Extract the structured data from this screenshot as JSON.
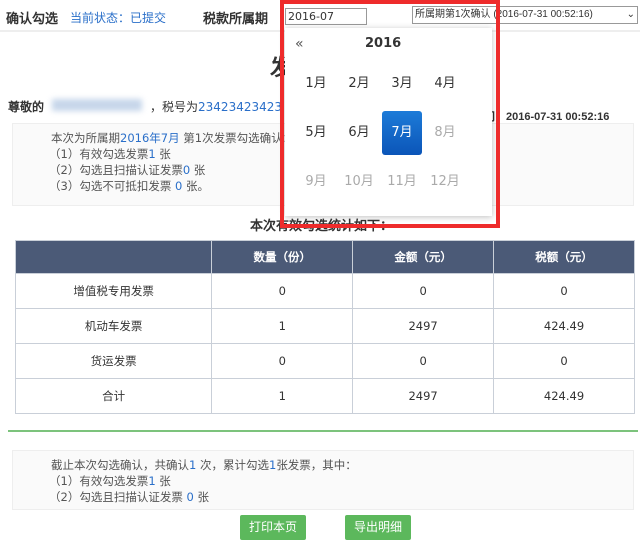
{
  "topbar": {
    "title": "确认勾选",
    "status": "当前状态：已提交",
    "period_label": "税款所属期",
    "period_value": "2016-07",
    "select_value": "所属期第1次确认 (2016-07-31 00:52:16)"
  },
  "main": {
    "heading": "发",
    "greeting": "尊敬的",
    "tax_label": "，税号为",
    "tax_id": "23423423423",
    "confirm_time": "认时间：2016-07-31 00:52:16"
  },
  "summary": {
    "line1_a": "本次为所属期",
    "line1_period": "2016年7月",
    "line1_b": " 第1次发票勾选确认：",
    "items": [
      {
        "a": "（1）有效勾选发票",
        "n": "1",
        "b": " 张"
      },
      {
        "a": "（2）勾选且扫描认证发票",
        "n": "0",
        "b": " 张"
      },
      {
        "a": "（3）勾选不可抵扣发票 ",
        "n": "0",
        "b": " 张。"
      }
    ]
  },
  "table": {
    "title": "本次有效勾选统计如下：",
    "headers": [
      "",
      "数量（份）",
      "金额（元）",
      "税额（元）"
    ],
    "rows": [
      [
        "增值税专用发票",
        "0",
        "0",
        "0"
      ],
      [
        "机动车发票",
        "1",
        "2497",
        "424.49"
      ],
      [
        "货运发票",
        "0",
        "0",
        "0"
      ],
      [
        "合计",
        "1",
        "2497",
        "424.49"
      ]
    ]
  },
  "cumulative": {
    "line1_a": "截止本次勾选确认，共确认",
    "count": "1",
    "line1_b": " 次，累计勾选",
    "total": "1",
    "line1_c": "张发票，其中：",
    "items": [
      {
        "a": "（1）有效勾选发票",
        "n": "1",
        "b": " 张"
      },
      {
        "a": "（2）勾选且扫描认证发票 ",
        "n": "0",
        "b": " 张"
      }
    ]
  },
  "buttons": {
    "print": "打印本页",
    "export": "导出明细"
  },
  "datepicker": {
    "prev": "«",
    "year": "2016",
    "months": [
      "1月",
      "2月",
      "3月",
      "4月",
      "5月",
      "6月",
      "7月",
      "8月",
      "9月",
      "10月",
      "11月",
      "12月"
    ],
    "selected": "7月",
    "max_enabled": 7
  },
  "colors": {
    "accent": "#2a6fc9",
    "header": "#4b5a77",
    "button": "#5cb85c",
    "highlight": "#ee2b2b",
    "selected": "#0b55b8"
  }
}
